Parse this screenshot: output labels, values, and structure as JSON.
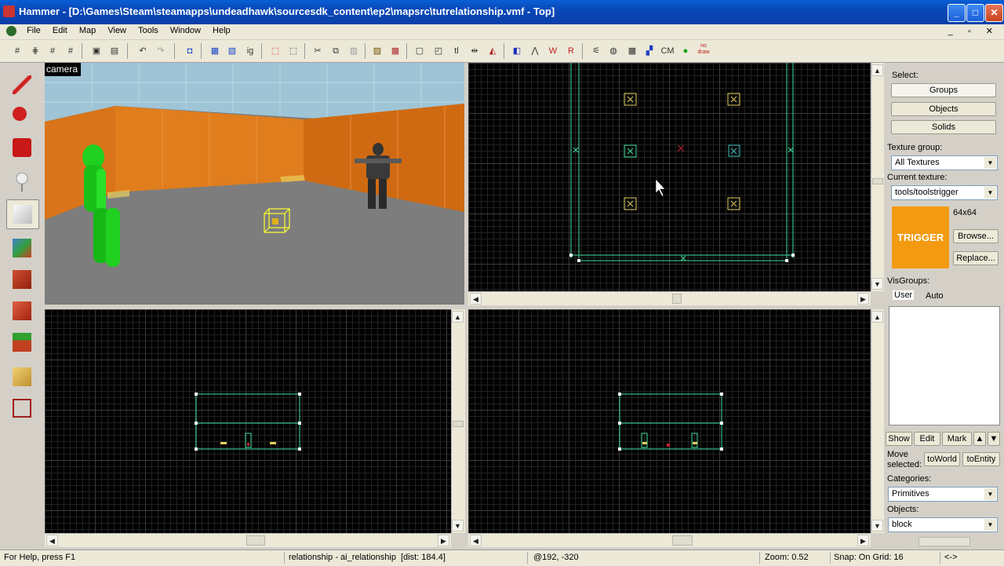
{
  "window": {
    "title": "Hammer - [D:\\Games\\Steam\\steamapps\\undeadhawk\\sourcesdk_content\\ep2\\mapsrc\\tutrelationship.vmf - Top]"
  },
  "menu": [
    "File",
    "Edit",
    "Map",
    "View",
    "Tools",
    "Window",
    "Help"
  ],
  "toolbar": {
    "ig_label": "ig",
    "tl_label": "tl",
    "cm_label": "CM",
    "nodraw_label": "no draw"
  },
  "camera": {
    "label": "camera"
  },
  "right_panel": {
    "select_label": "Select:",
    "groups": "Groups",
    "objects_btn": "Objects",
    "solids": "Solids",
    "texture_group_label": "Texture group:",
    "texture_group_value": "All Textures",
    "current_texture_label": "Current texture:",
    "current_texture_value": "tools/toolstrigger",
    "texture_preview_text": "TRIGGER",
    "texture_size": "64x64",
    "browse": "Browse...",
    "replace": "Replace...",
    "visgroups_label": "VisGroups:",
    "tab_user": "User",
    "tab_auto": "Auto",
    "show": "Show",
    "edit": "Edit",
    "mark": "Mark",
    "move_selected_label": "Move selected:",
    "to_world": "toWorld",
    "to_entity": "toEntity",
    "categories_label": "Categories:",
    "categories_value": "Primitives",
    "objects_label": "Objects:",
    "objects_value": "block",
    "colors": {
      "texture_bg": "#f39a10"
    }
  },
  "status": {
    "help": "For Help, press F1",
    "selection": "relationship - ai_relationship",
    "dist": "[dist: 184.4]",
    "coords": "@192, -320",
    "zoom": "Zoom: 0.52",
    "snap": "Snap: On Grid: 16",
    "arrow": "<->"
  }
}
